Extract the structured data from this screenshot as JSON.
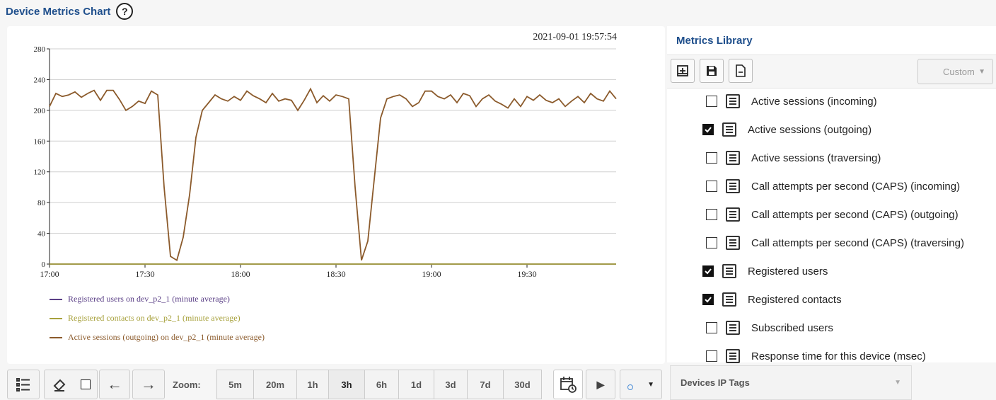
{
  "page": {
    "title": "Device Metrics Chart",
    "help_symbol": "?"
  },
  "chart": {
    "timestamp": "2021-09-01 19:57:54"
  },
  "chart_data": {
    "type": "line",
    "title": "",
    "xlabel": "",
    "ylabel": "",
    "x_ticks": [
      "17:00",
      "17:30",
      "18:00",
      "18:30",
      "19:00",
      "19:30"
    ],
    "x_range_minutes": [
      0,
      178
    ],
    "ylim": [
      0,
      280
    ],
    "y_ticks": [
      0,
      40,
      80,
      120,
      160,
      200,
      240,
      280
    ],
    "grid": true,
    "legend_position": "bottom-left",
    "series": [
      {
        "name": "Registered users on dev_p2_1 (minute average)",
        "color": "#5a3f86",
        "x": [
          0,
          178
        ],
        "y": [
          0,
          0
        ]
      },
      {
        "name": "Registered contacts on dev_p2_1 (minute average)",
        "color": "#a7a13c",
        "x": [
          0,
          178
        ],
        "y": [
          0,
          0
        ]
      },
      {
        "name": "Active sessions (outgoing) on dev_p2_1 (minute average)",
        "color": "#8b5a2b",
        "x": [
          0,
          2,
          4,
          6,
          8,
          10,
          12,
          14,
          16,
          18,
          20,
          22,
          24,
          26,
          28,
          30,
          32,
          34,
          36,
          38,
          40,
          42,
          44,
          46,
          48,
          50,
          52,
          54,
          56,
          58,
          60,
          62,
          64,
          66,
          68,
          70,
          72,
          74,
          76,
          78,
          80,
          82,
          84,
          86,
          88,
          90,
          92,
          94,
          96,
          98,
          100,
          102,
          104,
          106,
          108,
          110,
          112,
          114,
          116,
          118,
          120,
          122,
          124,
          126,
          128,
          130,
          132,
          134,
          136,
          138,
          140,
          142,
          144,
          146,
          148,
          150,
          152,
          154,
          156,
          158,
          160,
          162,
          164,
          166,
          168,
          170,
          172,
          174,
          176,
          178
        ],
        "y": [
          205,
          222,
          218,
          220,
          224,
          217,
          222,
          226,
          213,
          226,
          226,
          214,
          200,
          205,
          212,
          209,
          225,
          220,
          100,
          10,
          5,
          35,
          90,
          165,
          200,
          210,
          220,
          215,
          212,
          218,
          213,
          225,
          219,
          215,
          210,
          222,
          212,
          215,
          213,
          200,
          213,
          228,
          210,
          219,
          212,
          220,
          218,
          215,
          100,
          5,
          30,
          110,
          190,
          215,
          218,
          220,
          215,
          205,
          210,
          225,
          225,
          218,
          215,
          220,
          210,
          222,
          219,
          205,
          215,
          220,
          212,
          208,
          203,
          215,
          205,
          218,
          213,
          220,
          213,
          210,
          215,
          205,
          212,
          218,
          210,
          222,
          215,
          212,
          225,
          215
        ]
      }
    ]
  },
  "toolbar": {
    "zoom_label": "Zoom:",
    "zoom_options": [
      "5m",
      "20m",
      "1h",
      "3h",
      "6h",
      "1d",
      "3d",
      "7d",
      "30d"
    ],
    "active_zoom": "3h",
    "back_arrow": "←",
    "forward_arrow": "→",
    "play_symbol": "▶"
  },
  "library": {
    "title": "Metrics Library",
    "preset_select": "Custom",
    "metrics": [
      {
        "label": "Active sessions (incoming)",
        "checked": false
      },
      {
        "label": "Active sessions (outgoing)",
        "checked": true
      },
      {
        "label": "Active sessions (traversing)",
        "checked": false
      },
      {
        "label": "Call attempts per second (CAPS) (incoming)",
        "checked": false
      },
      {
        "label": "Call attempts per second (CAPS) (outgoing)",
        "checked": false
      },
      {
        "label": "Call attempts per second (CAPS) (traversing)",
        "checked": false
      },
      {
        "label": "Registered users",
        "checked": true
      },
      {
        "label": "Registered contacts",
        "checked": true
      },
      {
        "label": "Subscribed users",
        "checked": false
      },
      {
        "label": "Response time for this device (msec)",
        "checked": false
      }
    ]
  },
  "tags": {
    "label": "Devices IP Tags"
  }
}
